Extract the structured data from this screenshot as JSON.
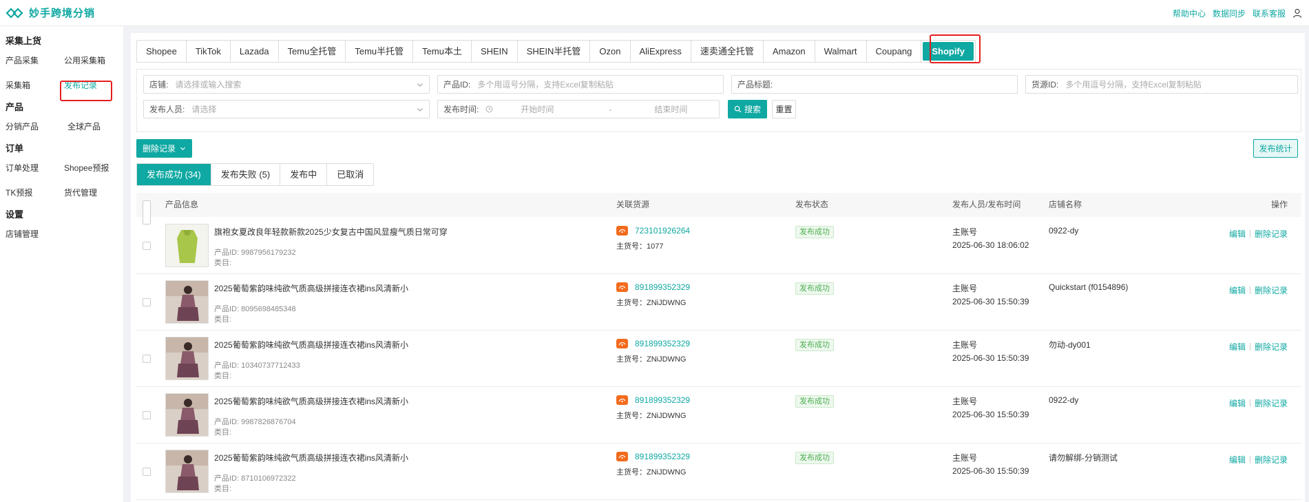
{
  "app": {
    "name": "妙手跨境分销"
  },
  "header": {
    "links": [
      "帮助中心",
      "数据同步",
      "联系客服"
    ]
  },
  "sidebar": {
    "groups": [
      {
        "title": "采集上货",
        "items": [
          "产品采集",
          "公用采集箱",
          "采集箱",
          "发布记录"
        ]
      },
      {
        "title": "产品",
        "items": [
          "分销产品",
          "全球产品"
        ]
      },
      {
        "title": "订单",
        "items": [
          "订单处理",
          "Shopee预报",
          "TK预报",
          "货代管理"
        ]
      },
      {
        "title": "设置",
        "items": [
          "店铺管理"
        ]
      }
    ]
  },
  "platform_tabs": [
    "Shopee",
    "TikTok",
    "Lazada",
    "Temu全托管",
    "Temu半托管",
    "Temu本土",
    "SHEIN",
    "SHEIN半托管",
    "Ozon",
    "AliExpress",
    "速卖通全托管",
    "Amazon",
    "Walmart",
    "Coupang",
    "Shopify"
  ],
  "active_platform": "Shopify",
  "filters": {
    "shop": {
      "label": "店铺:",
      "placeholder": "请选择或输入搜索"
    },
    "product_id": {
      "label": "产品ID:",
      "placeholder": "多个用逗号分隔，支持Excel复制粘贴"
    },
    "product_title": {
      "label": "产品标题:",
      "placeholder": ""
    },
    "supply_id": {
      "label": "货源ID:",
      "placeholder": "多个用逗号分隔，支持Excel复制粘贴"
    },
    "publisher": {
      "label": "发布人员:",
      "placeholder": "请选择"
    },
    "publish_time": {
      "label": "发布时间:",
      "start": "开始时间",
      "sep": "-",
      "end": "结束时间"
    },
    "search_label": "搜索",
    "reset_label": "重置"
  },
  "toolbar": {
    "delete_label": "删除记录",
    "stats_label": "发布统计"
  },
  "status_tabs": [
    "发布成功 (34)",
    "发布失败 (5)",
    "发布中",
    "已取消"
  ],
  "table": {
    "headers": [
      "产品信息",
      "关联货源",
      "发布状态",
      "发布人员/发布时间",
      "店铺名称",
      "操作"
    ],
    "rows": [
      {
        "title": "旗袍女夏改良年轻款新款2025少女复古中国风显瘦气质日常可穿",
        "product_id": "产品ID: 9987956179232",
        "category": "类目:",
        "source_id": "723101926264",
        "main_code": "主货号：1077",
        "status": "发布成功",
        "publisher": "主账号",
        "time": "2025-06-30 18:06:02",
        "shop": "0922-dy",
        "edit": "编辑",
        "delete": "删除记录",
        "thumb_color": "#a8c64a"
      },
      {
        "title": "2025葡萄紫韵味纯欲气质高级拼接连衣裙ins风清新小",
        "product_id": "产品ID: 8095698485348",
        "category": "类目:",
        "source_id": "891899352329",
        "main_code": "主货号：ZNiJDWNG",
        "status": "发布成功",
        "publisher": "主账号",
        "time": "2025-06-30 15:50:39",
        "shop": "Quickstart (f0154896)",
        "edit": "编辑",
        "delete": "删除记录",
        "thumb_color": "#8a5a6a"
      },
      {
        "title": "2025葡萄紫韵味纯欲气质高级拼接连衣裙ins风清新小",
        "product_id": "产品ID: 10340737712433",
        "category": "类目:",
        "source_id": "891899352329",
        "main_code": "主货号：ZNiJDWNG",
        "status": "发布成功",
        "publisher": "主账号",
        "time": "2025-06-30 15:50:39",
        "shop": "勿动-dy001",
        "edit": "编辑",
        "delete": "删除记录",
        "thumb_color": "#8a5a6a"
      },
      {
        "title": "2025葡萄紫韵味纯欲气质高级拼接连衣裙ins风清新小",
        "product_id": "产品ID: 9987826876704",
        "category": "类目:",
        "source_id": "891899352329",
        "main_code": "主货号：ZNiJDWNG",
        "status": "发布成功",
        "publisher": "主账号",
        "time": "2025-06-30 15:50:39",
        "shop": "0922-dy",
        "edit": "编辑",
        "delete": "删除记录",
        "thumb_color": "#8a5a6a"
      },
      {
        "title": "2025葡萄紫韵味纯欲气质高级拼接连衣裙ins风清新小",
        "product_id": "产品ID: 8710106972322",
        "category": "类目:",
        "source_id": "891899352329",
        "main_code": "主货号：ZNiJDWNG",
        "status": "发布成功",
        "publisher": "主账号",
        "time": "2025-06-30 15:50:39",
        "shop": "请勿解绑-分销测试",
        "edit": "编辑",
        "delete": "删除记录",
        "thumb_color": "#8a5a6a"
      }
    ]
  },
  "colors": {
    "accent": "#0fa8a2",
    "highlight": "#e61e1e",
    "source_icon": "#f26b1d"
  },
  "icons": {
    "logo": "diamond-logo-icon",
    "user": "user-icon",
    "chevron": "chevron-down-icon",
    "clock": "clock-icon",
    "search": "search-icon",
    "source": "1688-source-icon"
  }
}
